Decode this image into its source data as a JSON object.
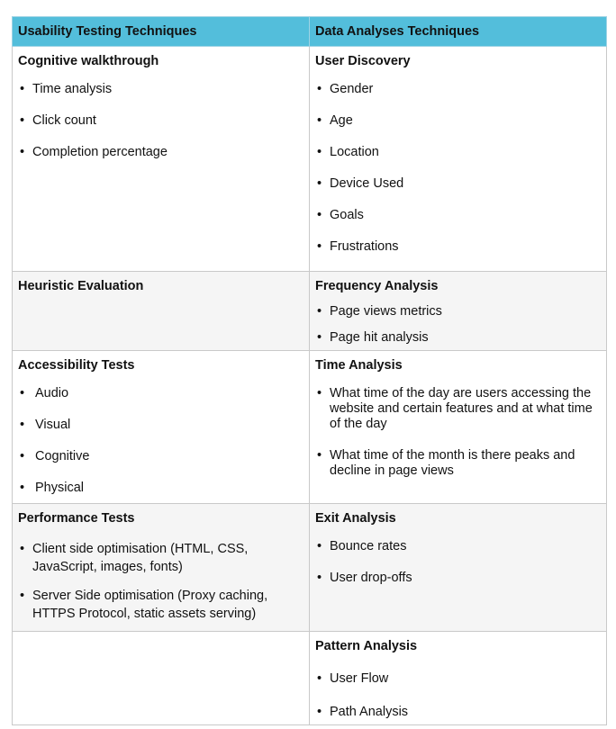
{
  "header": {
    "col1": "Usability Testing Techniques",
    "col2": "Data Analyses Techniques"
  },
  "rows": [
    {
      "left": {
        "title": "Cognitive walkthrough",
        "items": [
          "Time analysis",
          "Click count",
          "Completion percentage"
        ]
      },
      "right": {
        "title": "User Discovery",
        "items": [
          "Gender",
          "Age",
          "Location",
          "Device Used",
          "Goals",
          "Frustrations"
        ]
      }
    },
    {
      "left": {
        "title": "Heuristic Evaluation",
        "items": []
      },
      "right": {
        "title": "Frequency Analysis",
        "items": [
          "Page views metrics",
          "Page hit analysis"
        ]
      }
    },
    {
      "left": {
        "title": "Accessibility Tests",
        "items": [
          "Audio",
          "Visual",
          "Cognitive",
          "Physical"
        ]
      },
      "right": {
        "title": "Time Analysis",
        "items": [
          " What time of the day are users accessing the website and certain features and at what time of the day",
          "What time of the month is there peaks and decline in page views"
        ]
      }
    },
    {
      "left": {
        "title": "Performance Tests",
        "items": [
          "Client side optimisation (HTML, CSS, JavaScript, images, fonts)",
          "Server Side optimisation (Proxy caching, HTTPS Protocol, static assets serving)"
        ]
      },
      "right": {
        "title": "Exit Analysis",
        "items": [
          "Bounce rates",
          "User drop-offs"
        ]
      }
    },
    {
      "left": {
        "title": "",
        "items": []
      },
      "right": {
        "title": "Pattern Analysis",
        "items": [
          "User Flow",
          "Path Analysis"
        ]
      }
    }
  ]
}
